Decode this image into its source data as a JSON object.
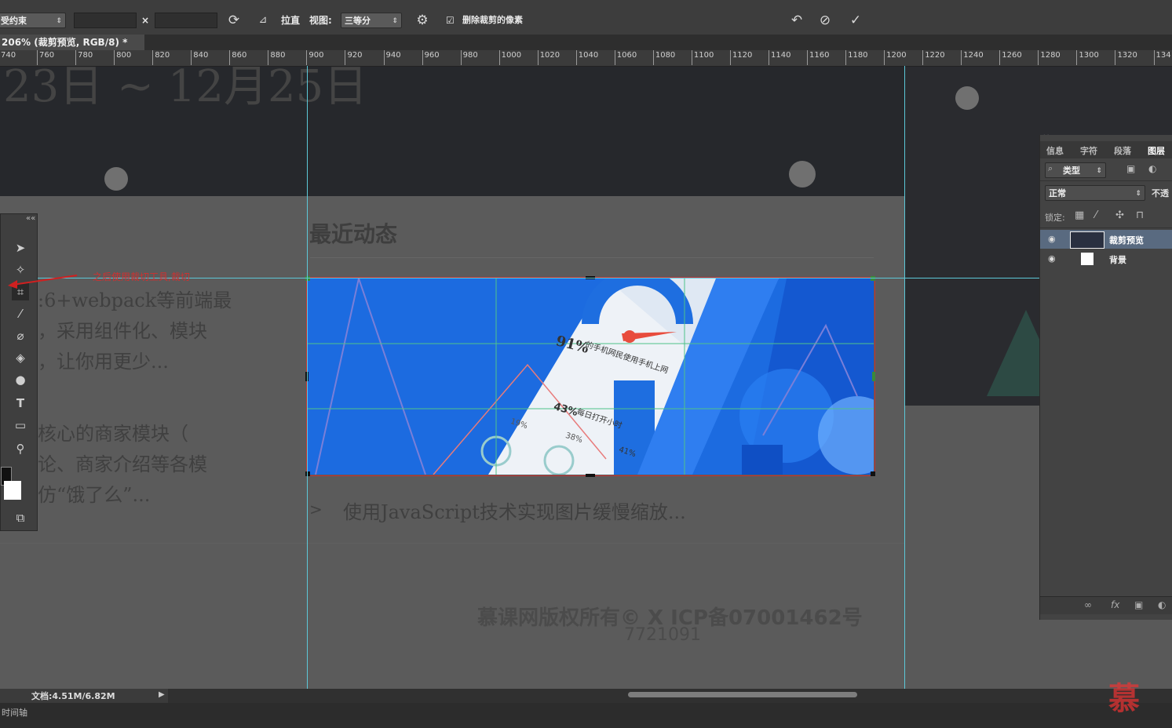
{
  "options_bar": {
    "constraint_select": "受约束",
    "swap_symbol": "×",
    "straighten_label": "拉直",
    "view_label": "视图:",
    "view_select": "三等分",
    "delete_cropped_label": "删除裁剪的像素",
    "delete_cropped_checked": true
  },
  "document_tab": {
    "label": "206% (裁剪预览, RGB/8) *"
  },
  "ruler": {
    "ticks": [
      "740",
      "760",
      "780",
      "800",
      "820",
      "840",
      "860",
      "880",
      "900",
      "920",
      "940",
      "960",
      "980",
      "1000",
      "1020",
      "1040",
      "1060",
      "1080",
      "1100",
      "1120",
      "1140",
      "1160",
      "1180",
      "1200",
      "1220",
      "1240",
      "1260",
      "1280",
      "1300",
      "1320",
      "134"
    ]
  },
  "canvas": {
    "date_text": "23日 ~ 12月25日",
    "section_title": "最近动态",
    "left_lines": [
      ":6+webpack等前端最",
      "，采用组件化、模块",
      "，让你用更少..."
    ],
    "left_lines2": [
      "核心的商家模块（",
      "论、商家介绍等各模",
      "仿“饿了么”..."
    ],
    "news_arrow": ">",
    "news_item": "使用JavaScript技术实现图片缓慢缩放...",
    "footer_line1": "慕课网版权所有© X ICP备07001462号",
    "footer_line2": "7721091"
  },
  "crop_image": {
    "stat1": "91%",
    "stat1_caption": "的手机网民使用手机上网",
    "stat2": "43%",
    "stat2_caption": "每日打开小时",
    "p1": "19%",
    "p2": "38%",
    "p3": "41%"
  },
  "annotation": {
    "text": "之后使用裁切工具,裁切"
  },
  "layers_panel": {
    "tabs": [
      "信息",
      "字符",
      "段落",
      "图层"
    ],
    "filter_select": "类型",
    "blend_select": "正常",
    "opacity_label": "不透",
    "lock_label": "锁定:",
    "layers": [
      {
        "name": "裁剪预览",
        "selected": true
      },
      {
        "name": "背景",
        "selected": false
      }
    ]
  },
  "status": {
    "doc_size": "文档:4.51M/6.82M",
    "timeline": "时间轴"
  },
  "watermark": "慕"
}
